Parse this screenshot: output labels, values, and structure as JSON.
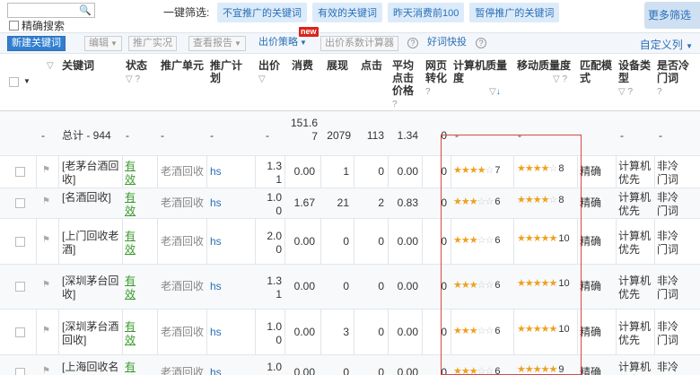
{
  "top": {
    "search_placeholder": "",
    "exact_search": "精确搜索",
    "quick_filter_label": "一键筛选:",
    "quick_tags": [
      "不宜推广的关键词",
      "有效的关键词",
      "昨天消费前100",
      "暂停推广的关键词"
    ],
    "more_filter": "更多筛选"
  },
  "toolbar": {
    "new_keyword": "新建关键词",
    "edit": "编辑",
    "promo": "推广实况",
    "report": "查看报告",
    "bid_strategy": "出价策略",
    "new_badge": "new",
    "bid_calc": "出价系数计算器",
    "keyword_tips": "好词快投",
    "custom_columns": "自定义列"
  },
  "headers": {
    "keyword": "关键词",
    "status": "状态",
    "unit": "推广单元",
    "plan": "推广计划",
    "bid": "出价",
    "cost": "消费",
    "impr": "展现",
    "click": "点击",
    "avg_cpc": "平均点击价格",
    "conv": "网页转化",
    "pc_quality": "计算机质量度",
    "mobile_quality": "移动质量度",
    "match": "匹配模式",
    "device": "设备类型",
    "cold": "是否冷门词"
  },
  "total": {
    "dash": "-",
    "label": "总计 - 944",
    "cost": "151.67",
    "impr": "2079",
    "click": "113",
    "avg_cpc": "1.34",
    "conv": "0"
  },
  "rows": [
    {
      "keyword": "[老茅台酒回收]",
      "status": "有效",
      "unit": "老酒回收",
      "plan": "hs",
      "bid": "1.31",
      "cost": "0.00",
      "impr": "1",
      "click": "0",
      "avg_cpc": "0.00",
      "conv": "0",
      "pc_stars": 3.5,
      "pc_score": "7",
      "m_stars": 4,
      "m_score": "8",
      "match": "精确",
      "device": "计算机优先",
      "cold": "非冷门词"
    },
    {
      "keyword": "[名酒回收]",
      "status": "有效",
      "unit": "老酒回收",
      "plan": "hs",
      "bid": "1.00",
      "cost": "1.67",
      "impr": "21",
      "click": "2",
      "avg_cpc": "0.83",
      "conv": "0",
      "pc_stars": 3,
      "pc_score": "6",
      "m_stars": 4,
      "m_score": "8",
      "match": "精确",
      "device": "计算机优先",
      "cold": "非冷门词"
    },
    {
      "keyword": "[上门回收老酒]",
      "status": "有效",
      "unit": "老酒回收",
      "plan": "hs",
      "bid": "2.00",
      "cost": "0.00",
      "impr": "0",
      "click": "0",
      "avg_cpc": "0.00",
      "conv": "0",
      "pc_stars": 3,
      "pc_score": "6",
      "m_stars": 5,
      "m_score": "10",
      "match": "精确",
      "device": "计算机优先",
      "cold": "非冷门词"
    },
    {
      "keyword": "[深圳茅台回收]",
      "status": "有效",
      "unit": "老酒回收",
      "plan": "hs",
      "bid": "1.31",
      "cost": "0.00",
      "impr": "0",
      "click": "0",
      "avg_cpc": "0.00",
      "conv": "0",
      "pc_stars": 3,
      "pc_score": "6",
      "m_stars": 5,
      "m_score": "10",
      "match": "精确",
      "device": "计算机优先",
      "cold": "非冷门词"
    },
    {
      "keyword": "[深圳茅台酒回收]",
      "status": "有效",
      "unit": "老酒回收",
      "plan": "hs",
      "bid": "1.00",
      "cost": "0.00",
      "impr": "3",
      "click": "0",
      "avg_cpc": "0.00",
      "conv": "0",
      "pc_stars": 3,
      "pc_score": "6",
      "m_stars": 5,
      "m_score": "10",
      "match": "精确",
      "device": "计算机优先",
      "cold": "非冷门词"
    },
    {
      "keyword": "[上海回收名",
      "status": "有效",
      "unit": "老酒回收",
      "plan": "hs",
      "bid": "1.00",
      "cost": "0.00",
      "impr": "0",
      "click": "0",
      "avg_cpc": "0.00",
      "conv": "0",
      "pc_stars": 3,
      "pc_score": "6",
      "m_stars": 4.5,
      "m_score": "9",
      "match": "精确",
      "device": "计算机优先",
      "cold": "非冷门词"
    }
  ],
  "colors": {
    "accent": "#2f7fd0",
    "star": "#f0a020",
    "highlight": "#d84848"
  }
}
